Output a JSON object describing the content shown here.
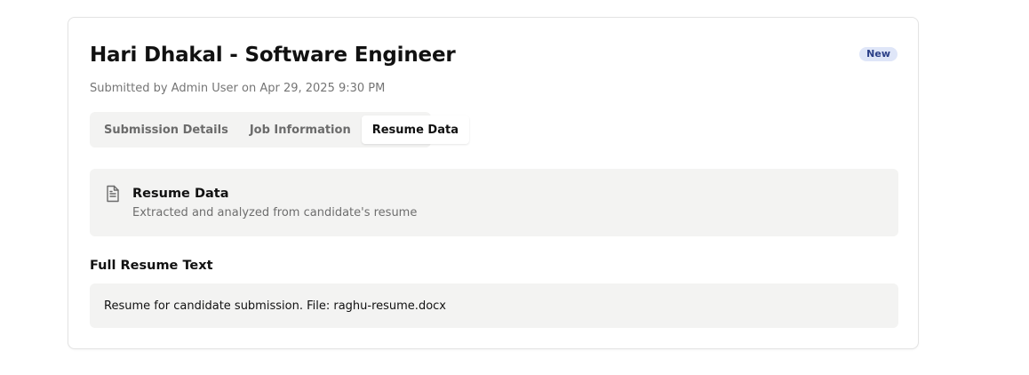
{
  "header": {
    "title": "Hari Dhakal - Software Engineer",
    "badge": "New",
    "subtitle": "Submitted by Admin User on Apr 29, 2025 9:30 PM"
  },
  "tabs": [
    {
      "label": "Submission Details",
      "active": false
    },
    {
      "label": "Job Information",
      "active": false
    },
    {
      "label": "Resume Data",
      "active": true
    }
  ],
  "resume_section": {
    "icon": "document-icon",
    "title": "Resume Data",
    "description": "Extracted and analyzed from candidate's resume"
  },
  "full_text": {
    "title": "Full Resume Text",
    "content": "Resume for candidate submission. File: raghu-resume.docx"
  },
  "colors": {
    "badge_bg": "#dfe6f8",
    "badge_text": "#2b3f87",
    "panel_bg": "#f3f3f2"
  }
}
